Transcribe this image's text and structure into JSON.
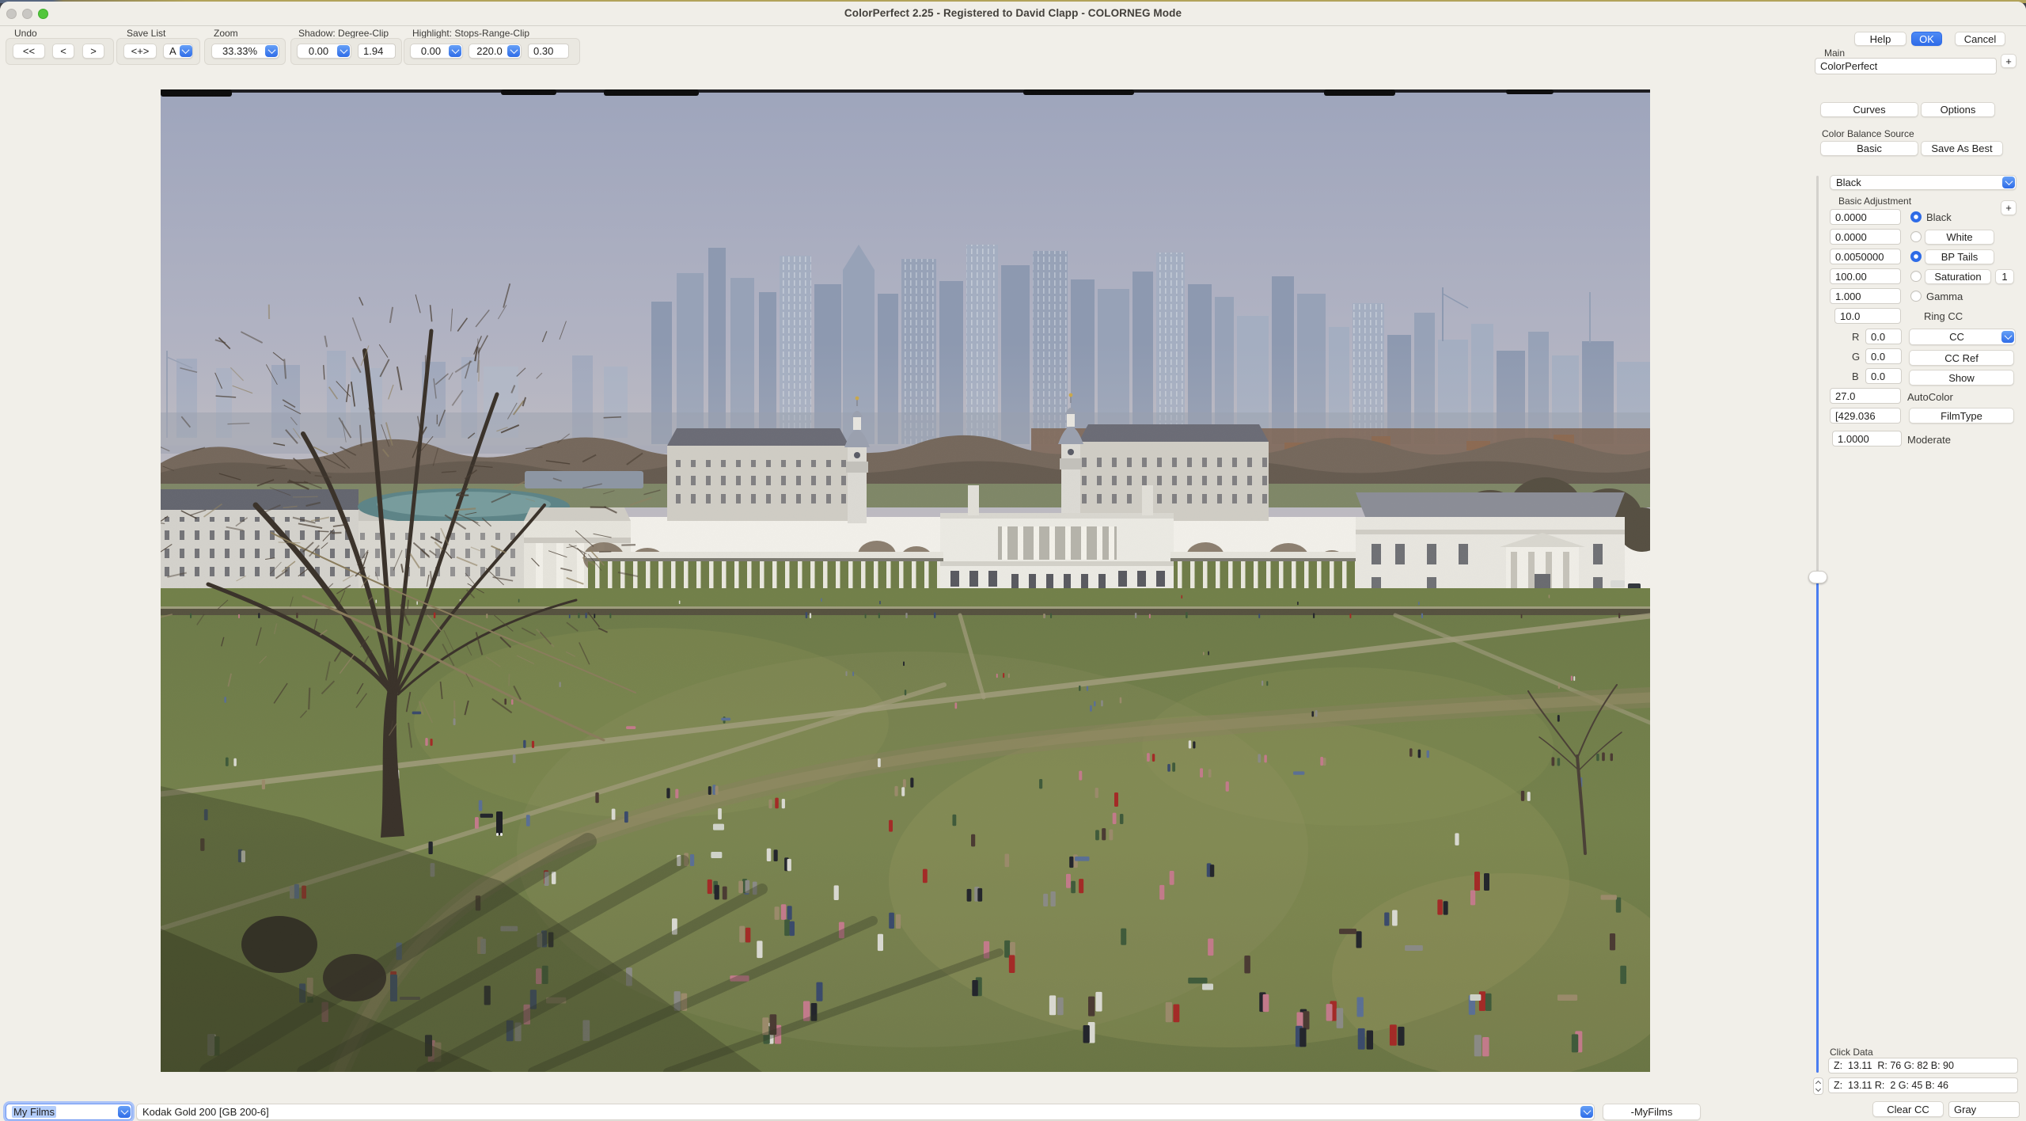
{
  "window": {
    "title": "ColorPerfect 2.25 - Registered to David Clapp - COLORNEG Mode"
  },
  "toolbar": {
    "undo_label": "Undo",
    "undo_back_all": "<<",
    "undo_back": "<",
    "undo_forward": ">",
    "savelist_label": "Save List",
    "savelist_add": "<+>",
    "savelist_slot": "A",
    "zoom_label": "Zoom",
    "zoom_value": "33.33%",
    "shadow_label": "Shadow: Degree-Clip",
    "shadow_degree": "0.00",
    "shadow_clip": "1.94",
    "highlight_label": "Highlight: Stops-Range-Clip",
    "highlight_stops": "0.00",
    "highlight_range": "220.0",
    "highlight_clip": "0.30"
  },
  "panel": {
    "help": "Help",
    "ok": "OK",
    "cancel": "Cancel",
    "main_label": "Main",
    "main_value": "ColorPerfect",
    "add_main": "+",
    "curves": "Curves",
    "options": "Options",
    "cbs_label": "Color Balance Source",
    "basic": "Basic",
    "save_as_best": "Save As Best",
    "mode_select": "Black",
    "basic_adjustment_label": "Basic Adjustment",
    "add_adjustment": "+",
    "black_value": "0.0000",
    "black_label": "Black",
    "white_value": "0.0000",
    "white_label": "White",
    "bptails_value": "0.0050000",
    "bptails_label": "BP Tails",
    "saturation_value": "100.00",
    "saturation_label": "Saturation",
    "saturation_extra": "1",
    "gamma_value": "1.000",
    "gamma_label": "Gamma",
    "ringcc_value": "10.0",
    "ringcc_label": "Ring CC",
    "r_label": "R",
    "r_value": "0.0",
    "g_label": "G",
    "g_value": "0.0",
    "b_label": "B",
    "b_value": "0.0",
    "cc_select": "CC",
    "cc_ref": "CC Ref",
    "show": "Show",
    "autocolor_value": "27.0",
    "autocolor_label": "AutoColor",
    "filmtype_value": "[429.036",
    "filmtype_label": "FilmType",
    "moderate_value": "1.0000",
    "moderate_label": "Moderate",
    "clickdata_label": "Click Data",
    "clickdata_row1": "Z:  13.11  R: 76 G: 82 B: 90",
    "clickdata_row2": "Z:  13.11 R:  2 G: 45 B: 46",
    "clear_cc": "Clear CC",
    "gray": "Gray"
  },
  "bottombar": {
    "films_select": "My Films",
    "film_name": "Kodak Gold 200 [GB 200-6]",
    "myfilms_button": "-MyFilms"
  },
  "colors": {
    "accent_blue": "#2f6ce8",
    "ok_button": "#3478f0",
    "slider_blue": "#4b7df0",
    "traffic_green": "#53c63c",
    "window_bg": "#f1efe9",
    "photo_sky": "#a4abc0",
    "photo_lawn": "#72804a",
    "photo_path": "#a29d7e",
    "people_palette": [
      "#23252b",
      "#3a4a6b",
      "#5a6f94",
      "#d8d8d0",
      "#a32a26",
      "#c27a8a",
      "#8a8a85",
      "#9a8a6a",
      "#3f5a3a",
      "#4a3a32"
    ]
  }
}
